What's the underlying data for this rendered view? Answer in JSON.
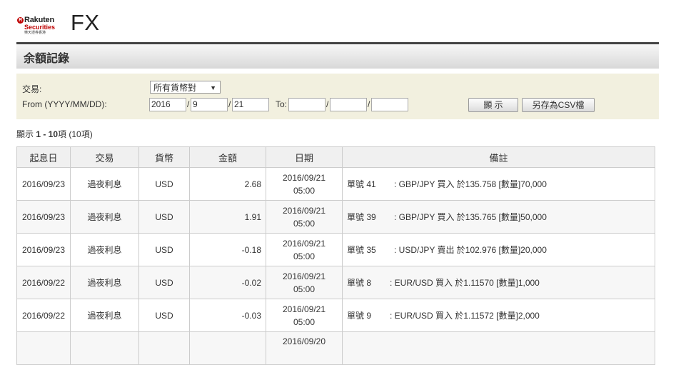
{
  "brand": {
    "logo_line1": "Rakuten",
    "logo_line2": "Securities",
    "logo_line3": "樂天證券香港",
    "product": "FX"
  },
  "page_title": "余額記錄",
  "filter": {
    "trade_label": "交易:",
    "pair_select": "所有貨幣對",
    "from_label": "From (YYYY/MM/DD):",
    "from_year": "2016",
    "from_month": "9",
    "from_day": "21",
    "to_label": "To:",
    "to_year": "",
    "to_month": "",
    "to_day": "",
    "show_button": "顯 示",
    "csv_button": "另存為CSV檔"
  },
  "result_count": {
    "prefix": "顯示 ",
    "range": "1 - 10",
    "unit": "項",
    "total": " (10項)"
  },
  "table": {
    "headers": [
      "起息日",
      "交易",
      "貨幣",
      "金額",
      "日期",
      "備註"
    ],
    "rows": [
      {
        "value_date": "2016/09/23",
        "type": "過夜利息",
        "currency": "USD",
        "amount": "2.68",
        "date": "2016/09/21",
        "time": "05:00",
        "memo_no": "單號 41",
        "memo": ": GBP/JPY 買入 於135.758 [數量]70,000"
      },
      {
        "value_date": "2016/09/23",
        "type": "過夜利息",
        "currency": "USD",
        "amount": "1.91",
        "date": "2016/09/21",
        "time": "05:00",
        "memo_no": "單號 39",
        "memo": ": GBP/JPY 買入 於135.765 [數量]50,000"
      },
      {
        "value_date": "2016/09/23",
        "type": "過夜利息",
        "currency": "USD",
        "amount": "-0.18",
        "date": "2016/09/21",
        "time": "05:00",
        "memo_no": "單號 35",
        "memo": ": USD/JPY 賣出 於102.976 [數量]20,000"
      },
      {
        "value_date": "2016/09/22",
        "type": "過夜利息",
        "currency": "USD",
        "amount": "-0.02",
        "date": "2016/09/21",
        "time": "05:00",
        "memo_no": "單號 8",
        "memo": ": EUR/USD 買入 於1.11570 [數量]1,000"
      },
      {
        "value_date": "2016/09/22",
        "type": "過夜利息",
        "currency": "USD",
        "amount": "-0.03",
        "date": "2016/09/21",
        "time": "05:00",
        "memo_no": "單號 9",
        "memo": ": EUR/USD 買入 於1.11572 [數量]2,000"
      },
      {
        "value_date": "",
        "type": "",
        "currency": "",
        "amount": "",
        "date": "2016/09/20",
        "time": "",
        "memo_no": "",
        "memo": ""
      }
    ]
  },
  "colors": {
    "brand_red": "#bf0000",
    "negative": "#cc0000",
    "filter_bg": "#f2f0df"
  }
}
